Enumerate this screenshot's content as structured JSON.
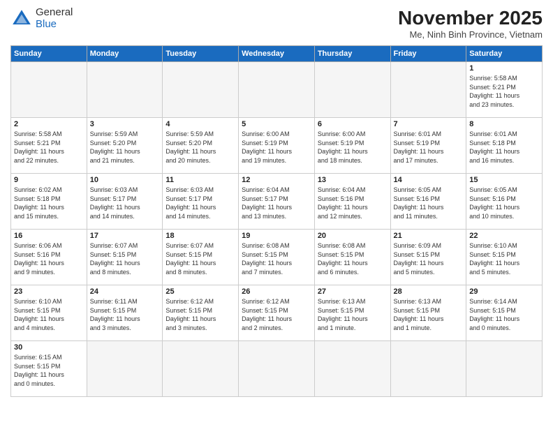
{
  "header": {
    "logo": {
      "general": "General",
      "blue": "Blue"
    },
    "title": "November 2025",
    "subtitle": "Me, Ninh Binh Province, Vietnam"
  },
  "weekdays": [
    "Sunday",
    "Monday",
    "Tuesday",
    "Wednesday",
    "Thursday",
    "Friday",
    "Saturday"
  ],
  "weeks": [
    [
      {
        "day": "",
        "info": ""
      },
      {
        "day": "",
        "info": ""
      },
      {
        "day": "",
        "info": ""
      },
      {
        "day": "",
        "info": ""
      },
      {
        "day": "",
        "info": ""
      },
      {
        "day": "",
        "info": ""
      },
      {
        "day": "1",
        "info": "Sunrise: 5:58 AM\nSunset: 5:21 PM\nDaylight: 11 hours\nand 23 minutes."
      }
    ],
    [
      {
        "day": "2",
        "info": "Sunrise: 5:58 AM\nSunset: 5:21 PM\nDaylight: 11 hours\nand 22 minutes."
      },
      {
        "day": "3",
        "info": "Sunrise: 5:59 AM\nSunset: 5:20 PM\nDaylight: 11 hours\nand 21 minutes."
      },
      {
        "day": "4",
        "info": "Sunrise: 5:59 AM\nSunset: 5:20 PM\nDaylight: 11 hours\nand 20 minutes."
      },
      {
        "day": "5",
        "info": "Sunrise: 6:00 AM\nSunset: 5:19 PM\nDaylight: 11 hours\nand 19 minutes."
      },
      {
        "day": "6",
        "info": "Sunrise: 6:00 AM\nSunset: 5:19 PM\nDaylight: 11 hours\nand 18 minutes."
      },
      {
        "day": "7",
        "info": "Sunrise: 6:01 AM\nSunset: 5:19 PM\nDaylight: 11 hours\nand 17 minutes."
      },
      {
        "day": "8",
        "info": "Sunrise: 6:01 AM\nSunset: 5:18 PM\nDaylight: 11 hours\nand 16 minutes."
      }
    ],
    [
      {
        "day": "9",
        "info": "Sunrise: 6:02 AM\nSunset: 5:18 PM\nDaylight: 11 hours\nand 15 minutes."
      },
      {
        "day": "10",
        "info": "Sunrise: 6:03 AM\nSunset: 5:17 PM\nDaylight: 11 hours\nand 14 minutes."
      },
      {
        "day": "11",
        "info": "Sunrise: 6:03 AM\nSunset: 5:17 PM\nDaylight: 11 hours\nand 14 minutes."
      },
      {
        "day": "12",
        "info": "Sunrise: 6:04 AM\nSunset: 5:17 PM\nDaylight: 11 hours\nand 13 minutes."
      },
      {
        "day": "13",
        "info": "Sunrise: 6:04 AM\nSunset: 5:16 PM\nDaylight: 11 hours\nand 12 minutes."
      },
      {
        "day": "14",
        "info": "Sunrise: 6:05 AM\nSunset: 5:16 PM\nDaylight: 11 hours\nand 11 minutes."
      },
      {
        "day": "15",
        "info": "Sunrise: 6:05 AM\nSunset: 5:16 PM\nDaylight: 11 hours\nand 10 minutes."
      }
    ],
    [
      {
        "day": "16",
        "info": "Sunrise: 6:06 AM\nSunset: 5:16 PM\nDaylight: 11 hours\nand 9 minutes."
      },
      {
        "day": "17",
        "info": "Sunrise: 6:07 AM\nSunset: 5:15 PM\nDaylight: 11 hours\nand 8 minutes."
      },
      {
        "day": "18",
        "info": "Sunrise: 6:07 AM\nSunset: 5:15 PM\nDaylight: 11 hours\nand 8 minutes."
      },
      {
        "day": "19",
        "info": "Sunrise: 6:08 AM\nSunset: 5:15 PM\nDaylight: 11 hours\nand 7 minutes."
      },
      {
        "day": "20",
        "info": "Sunrise: 6:08 AM\nSunset: 5:15 PM\nDaylight: 11 hours\nand 6 minutes."
      },
      {
        "day": "21",
        "info": "Sunrise: 6:09 AM\nSunset: 5:15 PM\nDaylight: 11 hours\nand 5 minutes."
      },
      {
        "day": "22",
        "info": "Sunrise: 6:10 AM\nSunset: 5:15 PM\nDaylight: 11 hours\nand 5 minutes."
      }
    ],
    [
      {
        "day": "23",
        "info": "Sunrise: 6:10 AM\nSunset: 5:15 PM\nDaylight: 11 hours\nand 4 minutes."
      },
      {
        "day": "24",
        "info": "Sunrise: 6:11 AM\nSunset: 5:15 PM\nDaylight: 11 hours\nand 3 minutes."
      },
      {
        "day": "25",
        "info": "Sunrise: 6:12 AM\nSunset: 5:15 PM\nDaylight: 11 hours\nand 3 minutes."
      },
      {
        "day": "26",
        "info": "Sunrise: 6:12 AM\nSunset: 5:15 PM\nDaylight: 11 hours\nand 2 minutes."
      },
      {
        "day": "27",
        "info": "Sunrise: 6:13 AM\nSunset: 5:15 PM\nDaylight: 11 hours\nand 1 minute."
      },
      {
        "day": "28",
        "info": "Sunrise: 6:13 AM\nSunset: 5:15 PM\nDaylight: 11 hours\nand 1 minute."
      },
      {
        "day": "29",
        "info": "Sunrise: 6:14 AM\nSunset: 5:15 PM\nDaylight: 11 hours\nand 0 minutes."
      }
    ],
    [
      {
        "day": "30",
        "info": "Sunrise: 6:15 AM\nSunset: 5:15 PM\nDaylight: 11 hours\nand 0 minutes."
      },
      {
        "day": "",
        "info": ""
      },
      {
        "day": "",
        "info": ""
      },
      {
        "day": "",
        "info": ""
      },
      {
        "day": "",
        "info": ""
      },
      {
        "day": "",
        "info": ""
      },
      {
        "day": "",
        "info": ""
      }
    ]
  ]
}
